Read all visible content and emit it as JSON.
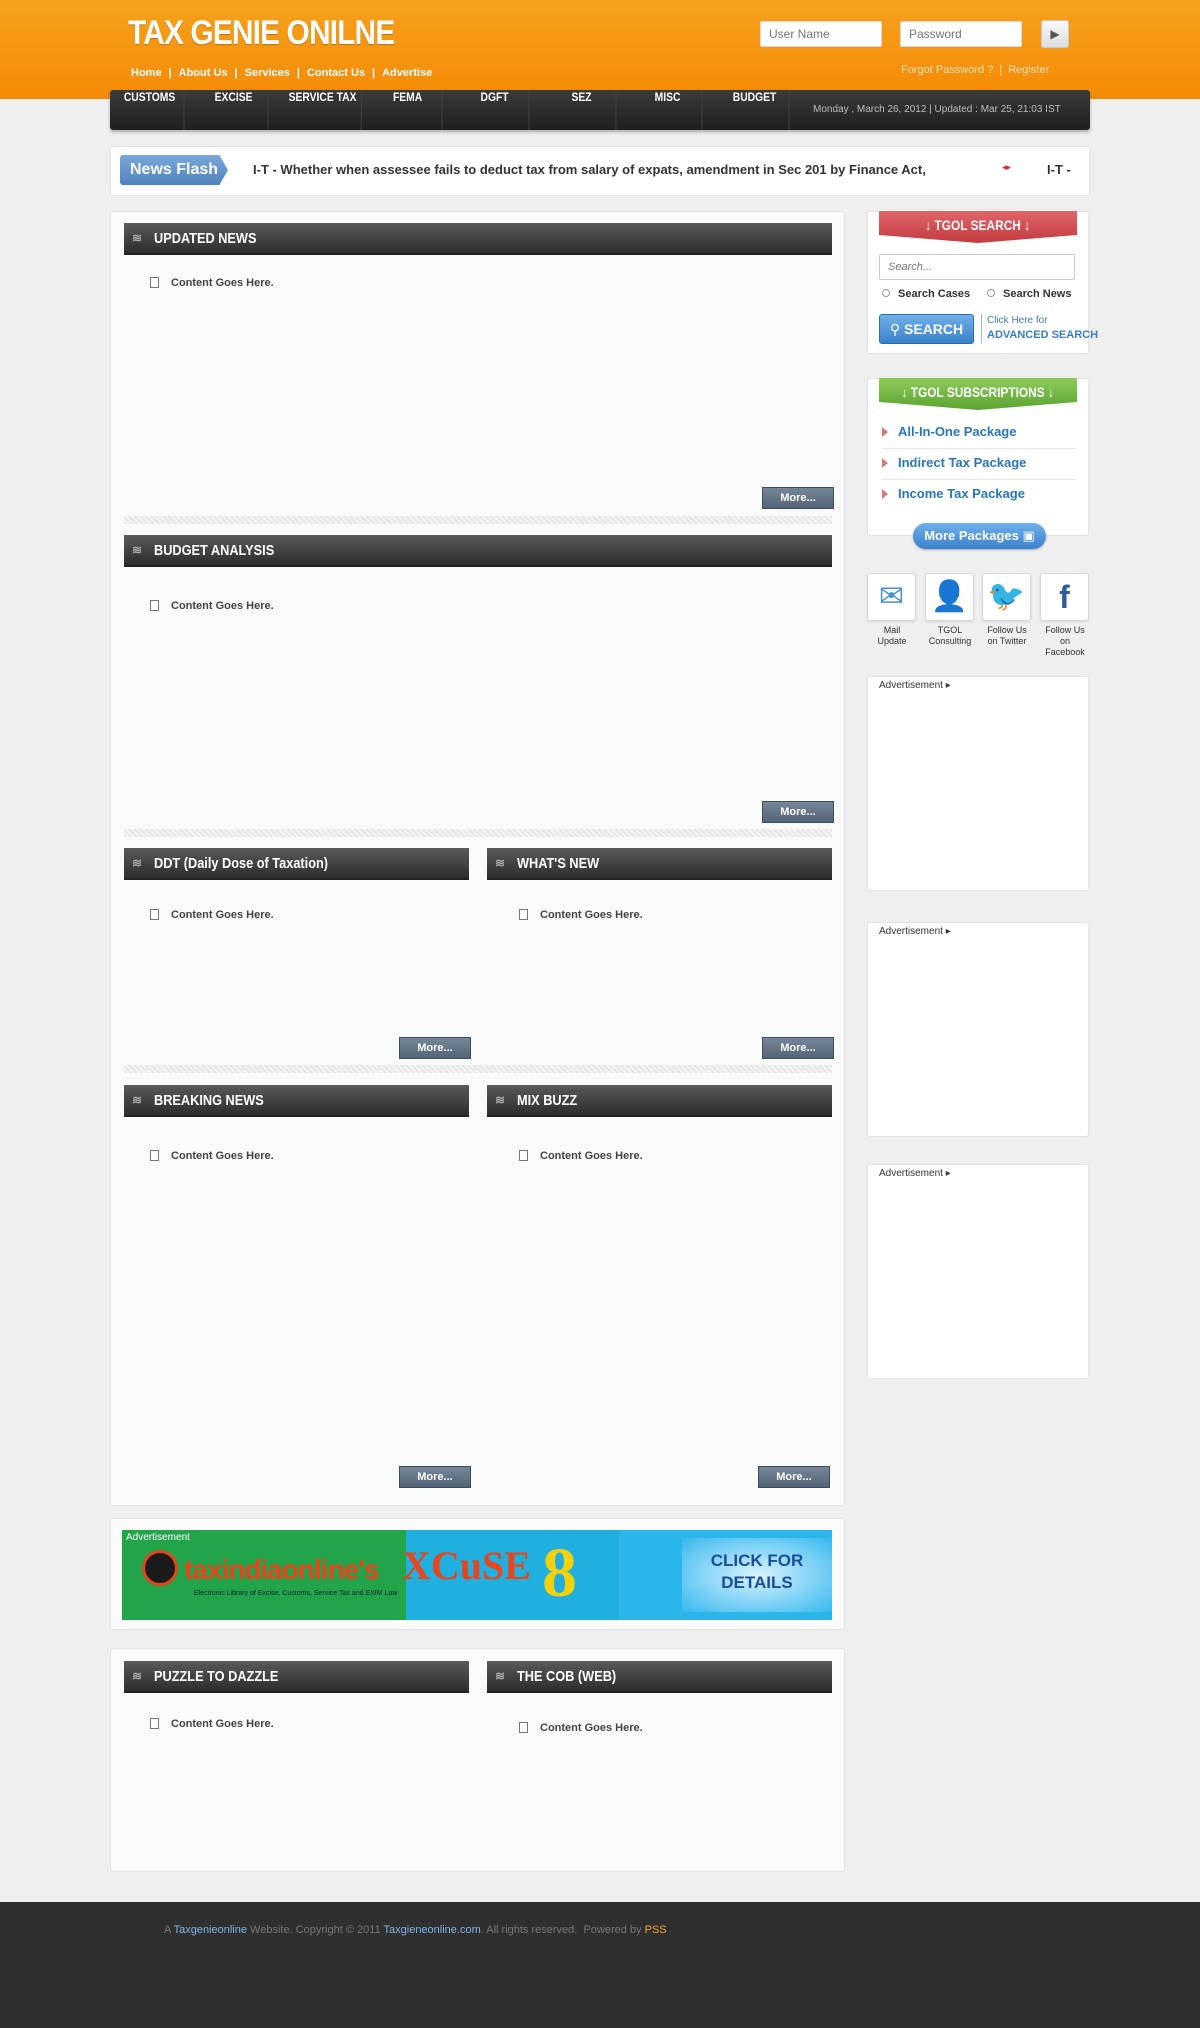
{
  "header": {
    "logo": "TAX GENIE ONILNE",
    "top_nav": [
      "Home",
      "About Us",
      "Services",
      "Contact Us",
      "Advertise"
    ],
    "username_placeholder": "User Name",
    "password_placeholder": "Password",
    "forgot_password": "Forgot Password ?",
    "register": "Register"
  },
  "main_nav": {
    "items": [
      "CUSTOMS",
      "EXCISE",
      "SERVICE TAX",
      "FEMA",
      "DGFT",
      "SEZ",
      "MISC",
      "BUDGET"
    ],
    "date_text": "Monday , March 26, 2012 | Updated : Mar 25, 21:03 IST"
  },
  "news_flash": {
    "label": "News Flash",
    "text": "I-T - Whether when assessee fails to deduct tax from salary of expats, amendment in Sec 201 by Finance Act,",
    "arrows": "◂▸",
    "next_text": "I-T -"
  },
  "sections": {
    "updated_news": {
      "title": "UPDATED NEWS",
      "content": "Content Goes Here.",
      "more": "More..."
    },
    "budget_analysis": {
      "title": "BUDGET ANALYSIS",
      "content": "Content Goes Here.",
      "more": "More..."
    },
    "ddt": {
      "title": "DDT (Daily Dose of Taxation)",
      "content": "Content Goes Here.",
      "more": "More..."
    },
    "whats_new": {
      "title": "WHAT'S NEW",
      "content": "Content Goes Here.",
      "more": "More..."
    },
    "breaking_news": {
      "title": "BREAKING NEWS",
      "content": "Content Goes Here.",
      "more": "More..."
    },
    "mix_buzz": {
      "title": "MIX BUZZ",
      "content": "Content Goes Here.",
      "more": "More..."
    },
    "puzzle": {
      "title": "PUZZLE TO DAZZLE",
      "content": "Content Goes Here."
    },
    "cob": {
      "title": "THE COB (WEB)",
      "content": "Content Goes Here."
    }
  },
  "banner": {
    "label": "Advertisement",
    "brand": "taxindiaonline's",
    "product": "XCuSE",
    "tagline": "Electronic Library of Excise, Customs, Service Tax and EXIM Law",
    "cta": "CLICK FOR DETAILS"
  },
  "sidebar": {
    "search_title": "↓ TGOL SEARCH ↓",
    "search_placeholder": "Search...",
    "radio_cases": "Search Cases",
    "radio_news": "Search News",
    "search_button": "SEARCH",
    "advanced_line1": "Click Here for",
    "advanced_line2": "ADVANCED SEARCH",
    "subs_title": "↓ TGOL SUBSCRIPTIONS ↓",
    "packages": [
      "All-In-One Package",
      "Indirect Tax Package",
      "Income Tax Package"
    ],
    "more_packages": "More Packages",
    "social": [
      {
        "label1": "Mail",
        "label2": "Update",
        "icon": "mail-icon"
      },
      {
        "label1": "TGOL",
        "label2": "Consulting",
        "icon": "consulting-icon"
      },
      {
        "label1": "Follow Us",
        "label2": "on Twitter",
        "icon": "twitter-icon"
      },
      {
        "label1": "Follow Us",
        "label2": "on Facebook",
        "icon": "facebook-icon"
      }
    ],
    "ad_label": "Advertisement ▸"
  },
  "footer": {
    "prefix": "A",
    "site": "Taxgenieonline",
    "middle": "Website. Copyright © 2011",
    "domain": "Taxgieneonline.com",
    "rights": ". All rights reserved.",
    "powered": "Powered by",
    "powered_by": "PSS"
  },
  "colors": {
    "brand_orange": "#f58a06",
    "nav_dark": "#2d2d2d",
    "link_blue": "#2a74b8"
  }
}
